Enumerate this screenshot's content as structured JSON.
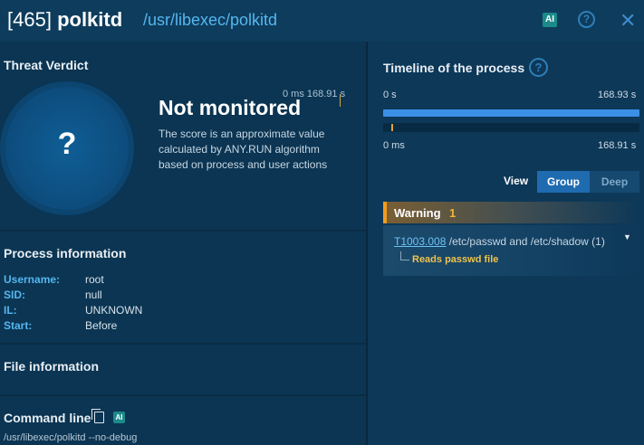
{
  "header": {
    "pid": "[465]",
    "process_name": "polkitd",
    "path": "/usr/libexec/polkitd",
    "ai_badge": "AI",
    "help_icon": "?",
    "close_icon": "✕"
  },
  "threat_verdict": {
    "title": "Threat Verdict",
    "symbol": "?",
    "status": "Not monitored",
    "time_label": "0 ms 168.91 s",
    "description": "The score is an approximate value calculated by ANY.RUN algorithm based on process and user actions"
  },
  "process_info": {
    "title": "Process information",
    "rows": [
      {
        "key": "Username:",
        "value": "root"
      },
      {
        "key": "SID:",
        "value": "null"
      },
      {
        "key": "IL:",
        "value": "UNKNOWN"
      },
      {
        "key": "Start:",
        "value": "Before"
      }
    ]
  },
  "file_info": {
    "title": "File information"
  },
  "command_line": {
    "title": "Command line",
    "ai_badge": "AI",
    "value": "/usr/libexec/polkitd --no-debug"
  },
  "timeline": {
    "title": "Timeline of the process",
    "help_icon": "?",
    "top_start": "0 s",
    "top_end": "168.93 s",
    "bottom_start": "0 ms",
    "bottom_end": "168.91 s"
  },
  "view": {
    "label": "View",
    "options": [
      "Group",
      "Deep"
    ],
    "selected": "Group"
  },
  "warning": {
    "label": "Warning",
    "count": "1",
    "technique_id": "T1003.008",
    "technique_desc": "/etc/passwd and /etc/shadow (1)",
    "sub_item": "Reads passwd file"
  },
  "colors": {
    "background": "#0b3552",
    "accent": "#55b6f0",
    "warning": "#f29b20",
    "timeline_bar": "#3b8fe6"
  }
}
